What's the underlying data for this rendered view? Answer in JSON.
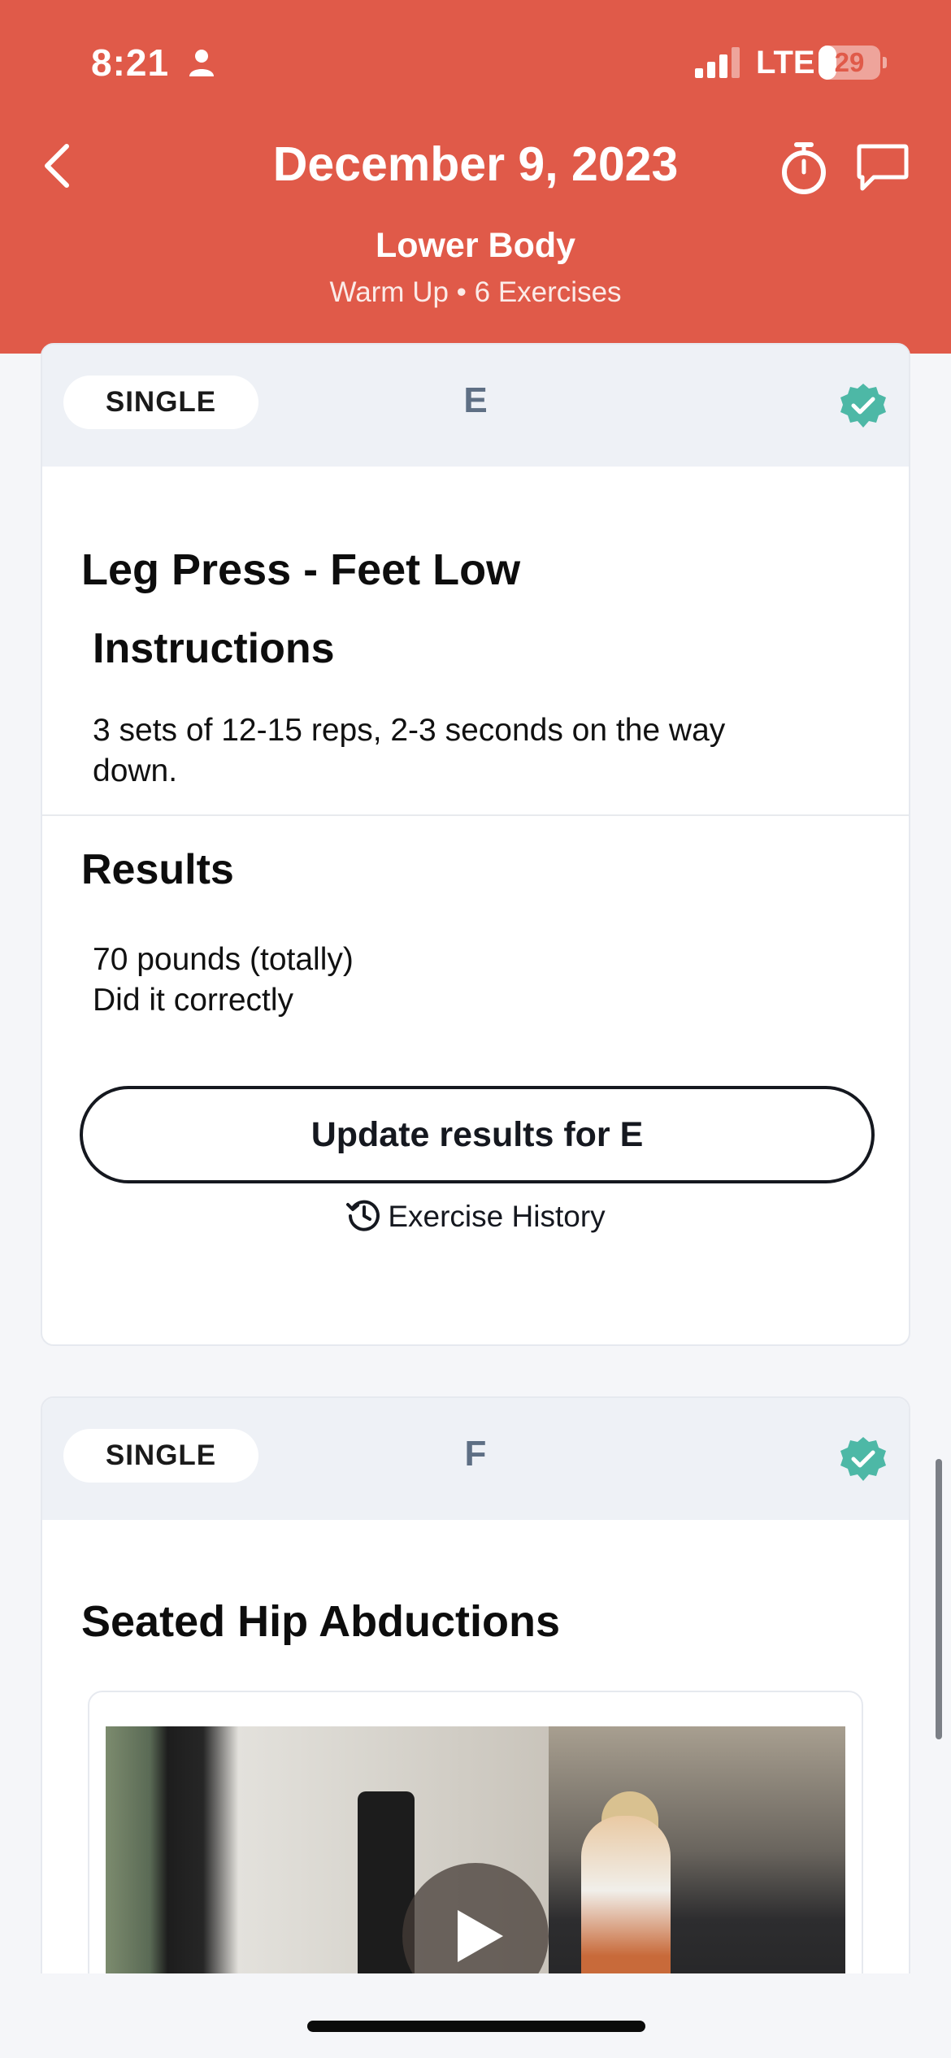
{
  "status_bar": {
    "time": "8:21",
    "carrier": "LTE",
    "battery_level": "29"
  },
  "header": {
    "title": "December 9, 2023",
    "subtitle": "Lower Body",
    "meta": "Warm Up • 6 Exercises"
  },
  "colors": {
    "brand": "#e05a49",
    "check": "#4db8a6",
    "letter": "#5e6f84"
  },
  "cards": [
    {
      "type": "SINGLE",
      "letter": "E",
      "exercise": "Leg Press - Feet Low",
      "instructions_heading": "Instructions",
      "instructions_line1": "3 sets of 12-15 reps, 2-3 seconds on the way",
      "instructions_line2": "down.",
      "results_heading": "Results",
      "result_line1": "70 pounds (totally)",
      "result_line2": "Did it correctly",
      "update_button": "Update results for E",
      "history_link": "Exercise History",
      "completed": true
    },
    {
      "type": "SINGLE",
      "letter": "F",
      "exercise": "Seated Hip Abductions",
      "completed": true,
      "has_video": true
    }
  ],
  "icons": [
    "person-icon",
    "signal-icon",
    "back-icon",
    "timer-icon",
    "chat-icon",
    "check-badge-icon",
    "history-icon",
    "play-icon"
  ]
}
